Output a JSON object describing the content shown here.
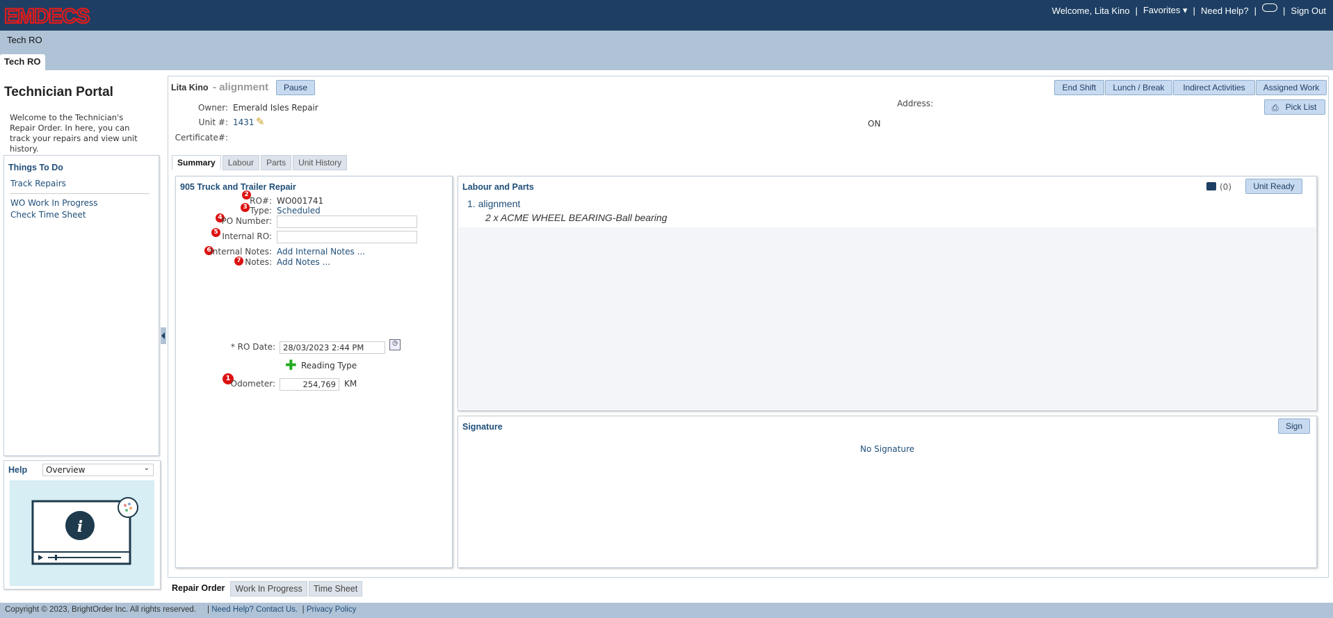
{
  "header": {
    "logo_text": "EMDECS",
    "welcome": "Welcome, Lita Kino",
    "favorites": "Favorites",
    "need_help": "Need Help?",
    "sign_out": "Sign Out"
  },
  "subbar": {
    "breadcrumb": "Tech RO",
    "tab": "Tech RO"
  },
  "left": {
    "title": "Technician Portal",
    "intro": "Welcome to the Technician's Repair Order. In here, you can track your repairs and view unit history.",
    "todo_title": "Things To Do",
    "todo_links": [
      "Track Repairs",
      "WO Work In Progress",
      "Check Time Sheet"
    ],
    "help_label": "Help",
    "help_select": "Overview"
  },
  "main": {
    "tech_name": "Lita Kino",
    "task_name": "- alignment",
    "pause": "Pause",
    "buttons": {
      "end_shift": "End Shift",
      "lunch_break": "Lunch / Break",
      "indirect": "Indirect Activities",
      "assigned": "Assigned Work",
      "pick_list": "Pick List"
    },
    "owner_label": "Owner:",
    "owner_value": "Emerald Isles Repair",
    "unit_label": "Unit #:",
    "unit_value": "1431",
    "cert_label": "Certificate#:",
    "address_label": "Address:",
    "address_value": "ON",
    "tabs": [
      "Summary",
      "Labour",
      "Parts",
      "Unit History"
    ]
  },
  "ro": {
    "title": "905 Truck and Trailer Repair",
    "ro_label": "RO#:",
    "ro_value": "WO001741",
    "type_label": "Type:",
    "type_value": "Scheduled",
    "po_label": "PO Number:",
    "po_value": "",
    "internal_ro_label": "Internal RO:",
    "internal_ro_value": "",
    "internal_notes_label": "Internal Notes:",
    "internal_notes_link": "Add Internal Notes ...",
    "notes_label": "Notes:",
    "notes_link": "Add Notes ...",
    "ro_date_label": "* RO Date:",
    "ro_date_value": "28/03/2023 2:44 PM",
    "reading_type": "Reading Type",
    "odometer_label": "Odometer:",
    "odometer_value": "254,769",
    "odometer_unit": "KM",
    "markers": [
      "1",
      "2",
      "3",
      "4",
      "5",
      "6",
      "7"
    ]
  },
  "labour_parts": {
    "title": "Labour and Parts",
    "count": "(0)",
    "unit_ready": "Unit Ready",
    "item": "1. alignment",
    "part": "2 x ACME WHEEL BEARING-Ball bearing"
  },
  "signature": {
    "title": "Signature",
    "sign": "Sign",
    "none": "No Signature"
  },
  "bottom_tabs": [
    "Repair Order",
    "Work In Progress",
    "Time Sheet"
  ],
  "footer": {
    "copyright": "Copyright © 2023, BrightOrder Inc. All rights reserved.",
    "help": "Need Help? Contact Us.",
    "privacy": "Privacy Policy"
  },
  "colors": {
    "header_bg": "#1e3f63",
    "subbar_bg": "#b0c3d6",
    "logo": "#e21b1b",
    "link": "#1f4e79",
    "marker": "#dd1111"
  }
}
